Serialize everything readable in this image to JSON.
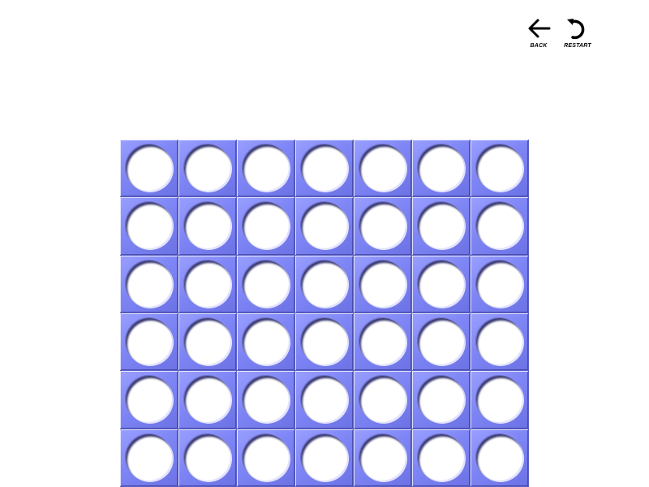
{
  "controls": {
    "back": {
      "label": "BACK",
      "icon": "arrow-left-icon"
    },
    "restart": {
      "label": "RESTART",
      "icon": "restart-icon"
    }
  },
  "board": {
    "columns": 7,
    "rows": 6,
    "cells": [
      [
        "empty",
        "empty",
        "empty",
        "empty",
        "empty",
        "empty",
        "empty"
      ],
      [
        "empty",
        "empty",
        "empty",
        "empty",
        "empty",
        "empty",
        "empty"
      ],
      [
        "empty",
        "empty",
        "empty",
        "empty",
        "empty",
        "empty",
        "empty"
      ],
      [
        "empty",
        "empty",
        "empty",
        "empty",
        "empty",
        "empty",
        "empty"
      ],
      [
        "empty",
        "empty",
        "empty",
        "empty",
        "empty",
        "empty",
        "empty"
      ],
      [
        "empty",
        "empty",
        "empty",
        "empty",
        "empty",
        "empty",
        "empty"
      ]
    ]
  },
  "colors": {
    "board": "#7e85f5",
    "hole": "#ffffff",
    "background": "#ffffff"
  }
}
